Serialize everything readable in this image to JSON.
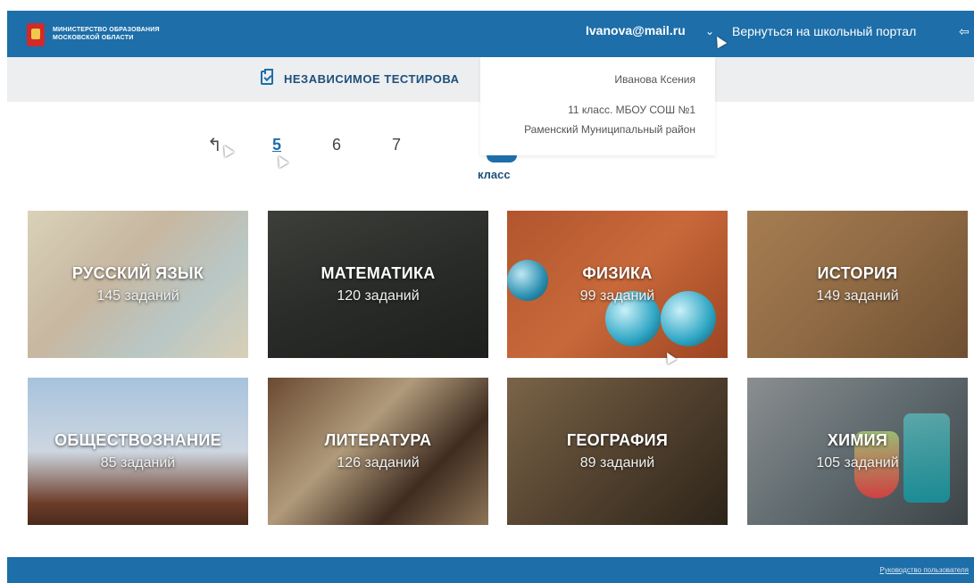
{
  "header": {
    "logo_line1": "МИНИСТЕРСТВО ОБРАЗОВАНИЯ",
    "logo_line2": "МОСКОВСКОЙ ОБЛАСТИ",
    "user_email": "Ivanova@mail.ru",
    "chevron_glyph": "⌄",
    "portal_link": "Вернуться на школьный портал",
    "exit_glyph": "⇦",
    "colors": {
      "brand": "#1d6ea9"
    }
  },
  "subheader": {
    "title": "НЕЗАВИСИМОЕ ТЕСТИРОВА"
  },
  "user_dropdown": {
    "name": "Иванова Ксения",
    "class_school": "11 класс. МБОУ СОШ №1",
    "district": "Раменский Муниципальный район"
  },
  "grade_selector": {
    "back_glyph": "↰",
    "grades": [
      "5",
      "6",
      "7"
    ],
    "selected": "5",
    "label": "класс"
  },
  "subjects": [
    {
      "name": "РУССКИЙ ЯЗЫК",
      "count": "145 заданий"
    },
    {
      "name": "МАТЕМАТИКА",
      "count": "120 заданий"
    },
    {
      "name": "ФИЗИКА",
      "count": "99 заданий"
    },
    {
      "name": "ИСТОРИЯ",
      "count": "149 заданий"
    },
    {
      "name": "ОБЩЕСТВОЗНАНИЕ",
      "count": "85 заданий"
    },
    {
      "name": "ЛИТЕРАТУРА",
      "count": "126 заданий"
    },
    {
      "name": "ГЕОГРАФИЯ",
      "count": "89 заданий"
    },
    {
      "name": "ХИМИЯ",
      "count": "105 заданий"
    }
  ],
  "footer": {
    "guide_link": "Руководство пользователя"
  }
}
